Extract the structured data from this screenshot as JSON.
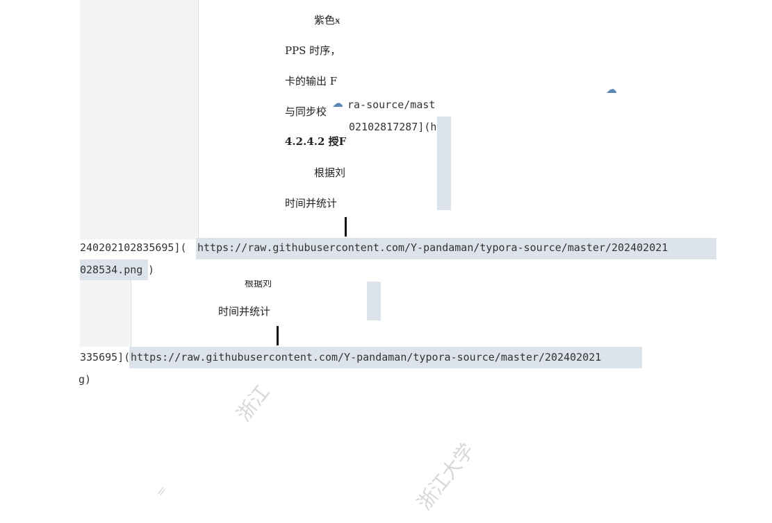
{
  "doc_upper": {
    "line1": "紫色ӿ",
    "line2": "PPS 时序，",
    "line3": "卡的输出 F",
    "line4": "与同步校",
    "heading": "4.2.4.2  授F",
    "line6": "根据刘",
    "line7": "时间并统计"
  },
  "overlay_upper": {
    "frag1": "ra-source/mast",
    "frag2": "02102817287](h"
  },
  "raw_line_1": {
    "prefix": "240202102835695](",
    "url": "https://raw.githubusercontent.com/Y-pandaman/typora-source/master/202402021",
    "cont": "028534.png",
    "close": ")"
  },
  "doc_lower": {
    "partial": "根据刘",
    "line": "时间并统计"
  },
  "raw_line_2": {
    "prefix": "335695](",
    "url": "https://raw.githubusercontent.com/Y-pandaman/typora-source/master/202402021",
    "cont": "g)"
  },
  "watermarks": [
    "浙江",
    "浙江大学",
    "="
  ],
  "icons": [
    "cloud-icon",
    "cloud-icon"
  ]
}
